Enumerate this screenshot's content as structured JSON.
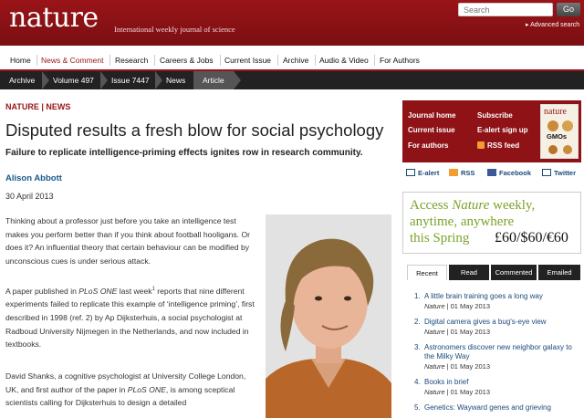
{
  "header": {
    "logo": "nature",
    "tagline": "International weekly journal of science",
    "search_placeholder": "Search",
    "go_label": "Go",
    "advanced_search": "▸ Advanced search"
  },
  "nav": [
    "Home",
    "News & Comment",
    "Research",
    "Careers & Jobs",
    "Current Issue",
    "Archive",
    "Audio & Video",
    "For Authors"
  ],
  "breadcrumb": [
    "Archive",
    "Volume 497",
    "Issue 7447",
    "News",
    "Article"
  ],
  "article": {
    "section": "NATURE | NEWS",
    "title": "Disputed results a fresh blow for social psychology",
    "standfirst": "Failure to replicate intelligence-priming effects ignites row in research community.",
    "author": "Alison Abbott",
    "date": "30 April 2013",
    "p1": "Thinking about a professor just before you take an intelligence test makes you perform better than if you think about football hooligans. Or does it? An influential theory that certain behaviour can be modified by unconscious cues is under serious attack.",
    "p2_a": "A paper published in ",
    "p2_journal": "PLoS ONE",
    "p2_b": " last week",
    "p2_sup": "1",
    "p2_c": " reports that nine different experiments failed to replicate this example of ‘intelligence priming’, first described in 1998 (ref. 2) by Ap Dijksterhuis, a social psychologist at Radboud University Nijmegen in the Netherlands, and now included in textbooks.",
    "p3_a": "David Shanks, a cognitive psychologist at University College London, UK, and first author of the paper in ",
    "p3_journal": "PLoS ONE",
    "p3_b": ", is among sceptical scientists calling for Dijksterhuis to design a detailed"
  },
  "sidebar": {
    "links": [
      "Journal home",
      "Subscribe",
      "Current issue",
      "E-alert sign up",
      "For authors",
      "RSS feed"
    ],
    "cover_title": "nature",
    "cover_gmo": "GMOs",
    "share": [
      "E-alert",
      "RSS",
      "Facebook",
      "Twitter"
    ],
    "ad": {
      "line1_a": "Access ",
      "line1_b": "Nature",
      "line1_c": " weekly,",
      "line2": "anytime, anywhere",
      "line3": "this Spring",
      "price": "£60/$60/€60"
    },
    "tabs": [
      "Recent",
      "Read",
      "Commented",
      "Emailed"
    ],
    "recent": [
      {
        "num": "1.",
        "title": "A little brain training goes a long way",
        "journal": "Nature",
        "date": " | 01 May 2013"
      },
      {
        "num": "2.",
        "title": "Digital camera gives a bug's-eye view",
        "journal": "Nature",
        "date": " | 01 May 2013"
      },
      {
        "num": "3.",
        "title": "Astronomers discover new neighbor galaxy to the Milky Way",
        "journal": "Nature",
        "date": " | 01 May 2013"
      },
      {
        "num": "4.",
        "title": "Books in brief",
        "journal": "Nature",
        "date": " | 01 May 2013"
      },
      {
        "num": "5.",
        "title": "Genetics: Wayward genes and grieving",
        "journal": "",
        "date": ""
      }
    ]
  },
  "colors": {
    "brand": "#9a1418",
    "link": "#1a4a7a",
    "ad_green": "#7aa32a"
  }
}
